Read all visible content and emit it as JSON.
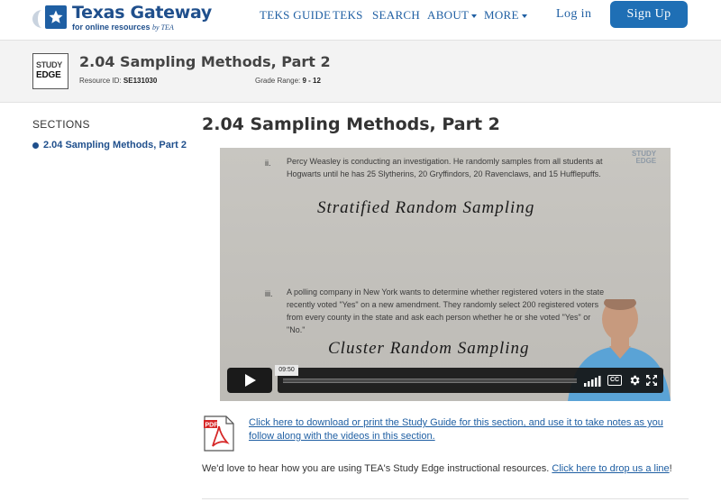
{
  "header": {
    "logo_title": "Texas Gateway",
    "logo_sub": "for online resources",
    "logo_by": "by TEA",
    "nav": [
      {
        "label": "TEKS GUIDE",
        "dropdown": false
      },
      {
        "label": "TEKS",
        "dropdown": false
      },
      {
        "label": "SEARCH",
        "dropdown": false
      },
      {
        "label": "ABOUT",
        "dropdown": true
      },
      {
        "label": "MORE",
        "dropdown": true
      }
    ],
    "login": "Log in",
    "signup": "Sign Up"
  },
  "banner": {
    "logo_line1": "STUDY",
    "logo_line2": "EDGE",
    "title": "2.04 Sampling Methods, Part 2",
    "resource_label": "Resource ID:",
    "resource_id": "SE131030",
    "grade_label": "Grade Range:",
    "grade_range": "9 - 12"
  },
  "sidebar": {
    "heading": "SECTIONS",
    "items": [
      "2.04 Sampling Methods, Part 2"
    ]
  },
  "main": {
    "title": "2.04 Sampling Methods, Part 2",
    "video": {
      "watermark_line1": "STUDY",
      "watermark_line2": "EDGE",
      "q2_num": "ii.",
      "q2_text": "Percy Weasley is conducting an investigation. He randomly samples from all students at Hogwarts until he has 25 Slytherins, 20 Gryffindors, 20 Ravenclaws, and 15 Hufflepuffs.",
      "q2_answer": "Stratified Random Sampling",
      "q3_num": "iii.",
      "q3_text": "A polling company in New York wants to determine whether registered voters in the state recently voted \"Yes\" on a new amendment. They randomly select 200 registered voters from every county in the state and ask each person whether he or she voted \"Yes\" or \"No.\"",
      "q3_answer": "Cluster Random Sampling",
      "time": "09:50",
      "progress": 0.0,
      "cc_label": "CC"
    },
    "download_text": "Click here to download or print the Study Guide for this section, and use it to take notes as you follow along with the videos in this section.",
    "pdf_label": "PDF",
    "feedback_text": "We'd love to hear how you are using TEA's Study Edge instructional resources. ",
    "feedback_link": "Click here to drop us a line",
    "feedback_end": "!"
  },
  "colors": {
    "brand_blue": "#1f5fa3",
    "signup_bg": "#1f6fb5",
    "banner_bg": "#f3f3f3"
  }
}
